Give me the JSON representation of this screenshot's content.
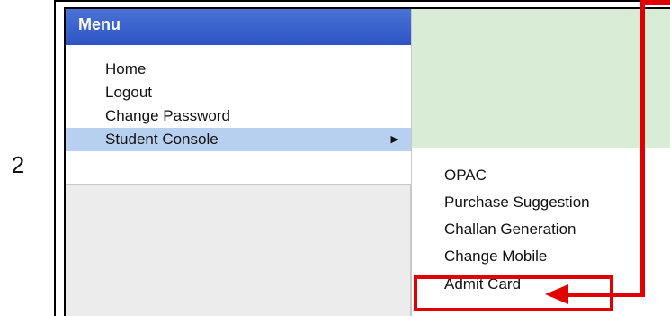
{
  "step_number": "2",
  "menu": {
    "header": "Menu",
    "items": [
      {
        "label": "Home"
      },
      {
        "label": "Logout"
      },
      {
        "label": "Change Password"
      },
      {
        "label": "Student Console",
        "has_submenu": true,
        "active": true
      }
    ],
    "submenu_arrow_icon": "triangle-right-icon"
  },
  "submenu": {
    "items": [
      {
        "label": "OPAC"
      },
      {
        "label": "Purchase Suggestion"
      },
      {
        "label": "Challan Generation"
      },
      {
        "label": "Change Mobile"
      },
      {
        "label": "Admit Card",
        "highlighted": true
      }
    ]
  },
  "annotation": {
    "color": "#e00000",
    "target": "Admit Card"
  },
  "colors": {
    "header": "#2c55c4",
    "active_item": "#b8d0ef",
    "content_area": "#d9ecd6"
  }
}
